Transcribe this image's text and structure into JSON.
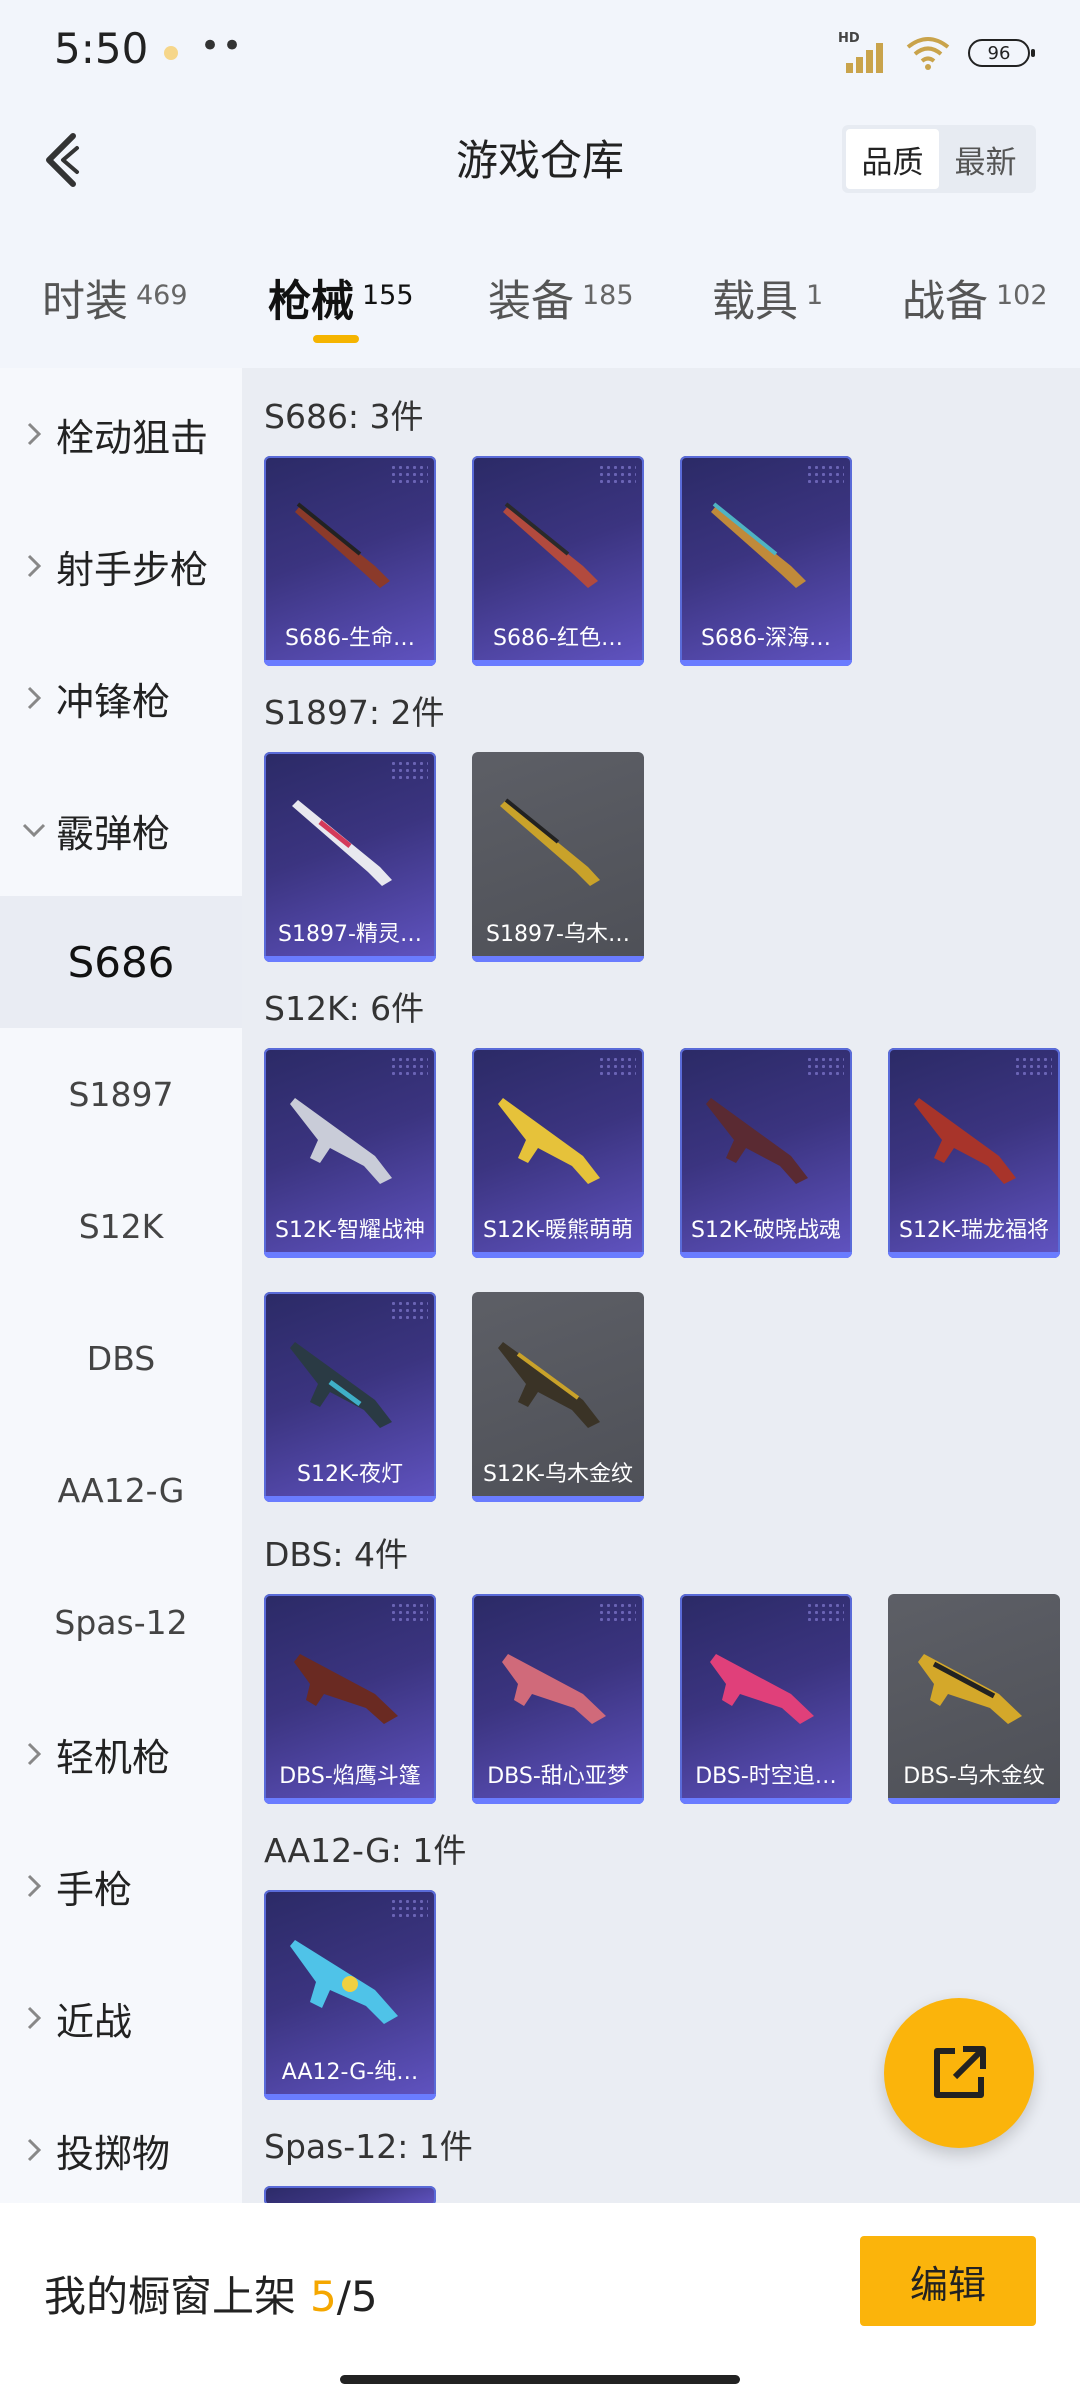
{
  "status_bar": {
    "time": "5:50",
    "battery": "96",
    "network": "HD"
  },
  "header": {
    "title": "游戏仓库",
    "sort_options": [
      "品质",
      "最新"
    ]
  },
  "tabs": [
    {
      "label": "时装",
      "count": "469"
    },
    {
      "label": "枪械",
      "count": "155"
    },
    {
      "label": "装备",
      "count": "185"
    },
    {
      "label": "载具",
      "count": "1"
    },
    {
      "label": "战备",
      "count": "102"
    }
  ],
  "sidebar": {
    "categories_top": [
      "栓动狙击",
      "射手步枪",
      "冲锋枪",
      "霰弹枪"
    ],
    "subitems": [
      "S686",
      "S1897",
      "S12K",
      "DBS",
      "AA12-G",
      "Spas-12"
    ],
    "categories_bottom": [
      "轻机枪",
      "手枪",
      "近战",
      "投掷物"
    ]
  },
  "groups": [
    {
      "title": "S686: 3件",
      "items": [
        "S686-生命…",
        "S686-红色…",
        "S686-深海…"
      ]
    },
    {
      "title": "S1897: 2件",
      "items": [
        "S1897-精灵…",
        "S1897-乌木…"
      ]
    },
    {
      "title": "S12K: 6件",
      "items": [
        "S12K-智耀战神",
        "S12K-暖熊萌萌",
        "S12K-破晓战魂",
        "S12K-瑞龙福将",
        "S12K-夜灯",
        "S12K-乌木金纹"
      ]
    },
    {
      "title": "DBS: 4件",
      "items": [
        "DBS-焰鹰斗篷",
        "DBS-甜心亚梦",
        "DBS-时空追…",
        "DBS-乌木金纹"
      ]
    },
    {
      "title": "AA12-G: 1件",
      "items": [
        "AA12-G-纯…"
      ]
    },
    {
      "title": "Spas-12: 1件",
      "items": []
    }
  ],
  "bottom": {
    "show_label": "我的橱窗上架",
    "show_current": "5",
    "show_sep": "/",
    "show_total": "5",
    "edit_label": "编辑"
  },
  "colors": {
    "accent": "#fbb40b",
    "card_purple": "#3b3480",
    "card_gray": "#55575e"
  }
}
